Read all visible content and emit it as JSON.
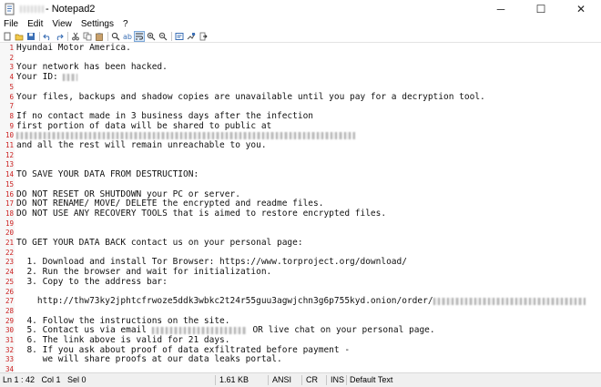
{
  "window": {
    "title": "- Notepad2",
    "controls": {
      "minimize": "─",
      "maximize": "☐",
      "close": "✕"
    }
  },
  "menu": [
    "File",
    "Edit",
    "View",
    "Settings",
    "?"
  ],
  "toolbar": [
    "new-file-icon",
    "open-folder-icon",
    "save-icon",
    "undo-icon",
    "redo-icon",
    "cut-icon",
    "copy-icon",
    "paste-icon",
    "find-icon",
    "replace-icon",
    "word-wrap-icon",
    "zoom-in-icon",
    "zoom-out-icon",
    "scheme-icon",
    "customize-icon",
    "exit-icon"
  ],
  "lines": [
    {
      "n": "1",
      "text": "Hyundai Motor America."
    },
    {
      "n": "2",
      "text": ""
    },
    {
      "n": "3",
      "text": "Your network has been hacked."
    },
    {
      "n": "4",
      "text": "Your ID: "
    },
    {
      "n": "5",
      "text": ""
    },
    {
      "n": "6",
      "text": "Your files, backups and shadow copies are unavailable until you pay for a decryption tool."
    },
    {
      "n": "7",
      "text": ""
    },
    {
      "n": "8",
      "text": "If no contact made in 3 business days after the infection"
    },
    {
      "n": "9",
      "text": "first portion of data will be shared to public at"
    },
    {
      "n": "10",
      "text": ""
    },
    {
      "n": "11",
      "text": "and all the rest will remain unreachable to you."
    },
    {
      "n": "12",
      "text": ""
    },
    {
      "n": "13",
      "text": ""
    },
    {
      "n": "14",
      "text": "TO SAVE YOUR DATA FROM DESTRUCTION:"
    },
    {
      "n": "15",
      "text": ""
    },
    {
      "n": "16",
      "text": "DO NOT RESET OR SHUTDOWN your PC or server."
    },
    {
      "n": "17",
      "text": "DO NOT RENAME/ MOVE/ DELETE the encrypted and readme files."
    },
    {
      "n": "18",
      "text": "DO NOT USE ANY RECOVERY TOOLS that is aimed to restore encrypted files."
    },
    {
      "n": "19",
      "text": ""
    },
    {
      "n": "20",
      "text": ""
    },
    {
      "n": "21",
      "text": "TO GET YOUR DATA BACK contact us on your personal page:"
    },
    {
      "n": "22",
      "text": ""
    },
    {
      "n": "23",
      "text": "  1. Download and install Tor Browser: https://www.torproject.org/download/"
    },
    {
      "n": "24",
      "text": "  2. Run the browser and wait for initialization."
    },
    {
      "n": "25",
      "text": "  3. Copy to the address bar:"
    },
    {
      "n": "26",
      "text": ""
    },
    {
      "n": "27",
      "text": "    http://thw73ky2jphtcfrwoze5ddk3wbkc2t24r55guu3agwjchn3g6p755kyd.onion/order/"
    },
    {
      "n": "28",
      "text": ""
    },
    {
      "n": "29",
      "text": "  4. Follow the instructions on the site."
    },
    {
      "n": "30",
      "text": "  5. Contact us via email "
    },
    {
      "n": "31",
      "text": "  6. The link above is valid for 21 days."
    },
    {
      "n": "32",
      "text": "  8. If you ask about proof of data exfiltrated before payment -"
    },
    {
      "n": "33",
      "text": "     we will share proofs at our data leaks portal."
    },
    {
      "n": "34",
      "text": ""
    }
  ],
  "line30_suffix": " OR live chat on your personal page.",
  "status": {
    "position": "Ln 1 : 42   Col 1   Sel 0",
    "size": "1.61 KB",
    "encoding": "ANSI",
    "line_ending": "CR",
    "mode": "INS",
    "scheme": "Default Text"
  }
}
